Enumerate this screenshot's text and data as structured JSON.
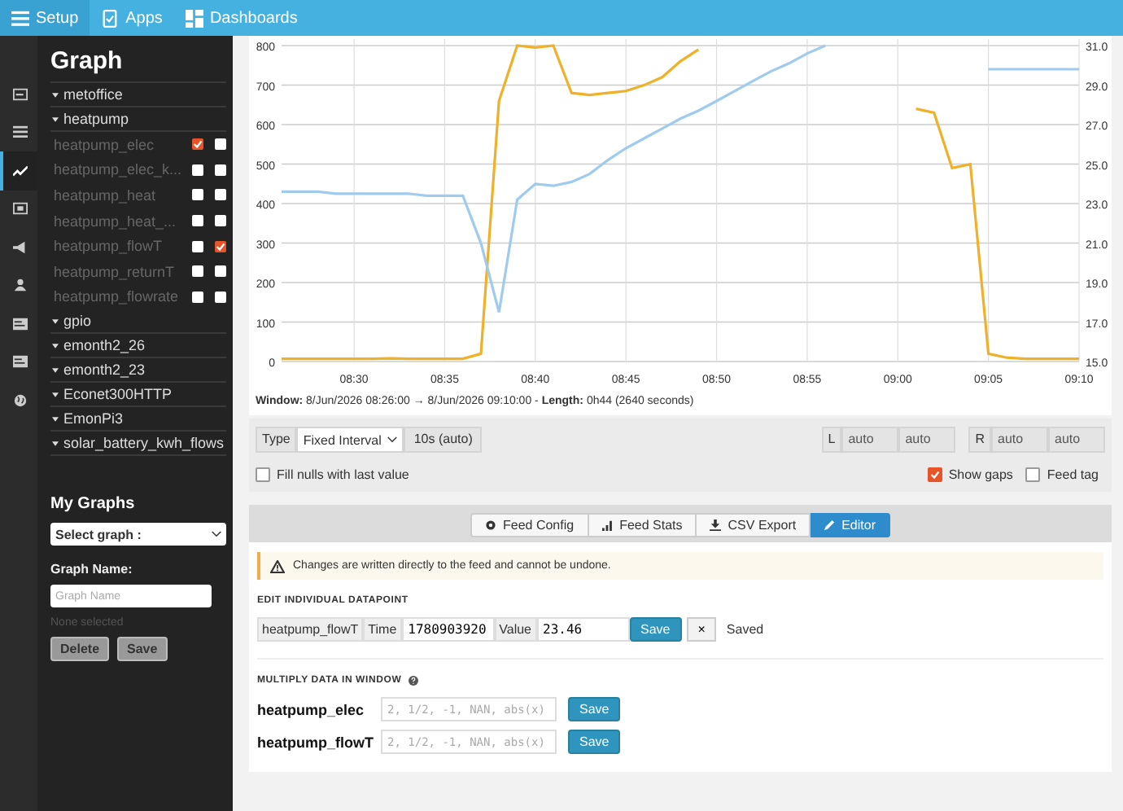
{
  "navbar": {
    "items": [
      {
        "label": "Setup",
        "kind": "menu",
        "selected": true
      },
      {
        "label": "Apps",
        "kind": "apps",
        "selected": false
      },
      {
        "label": "Dashboards",
        "kind": "dashboards",
        "selected": false
      }
    ]
  },
  "rail": [
    {
      "kind": "input",
      "selected": false
    },
    {
      "kind": "list",
      "selected": false
    },
    {
      "kind": "graph",
      "selected": true
    },
    {
      "kind": "box",
      "selected": false
    },
    {
      "kind": "megaphone",
      "selected": false
    },
    {
      "kind": "user",
      "selected": false
    },
    {
      "kind": "card",
      "selected": false
    },
    {
      "kind": "card",
      "selected": false
    },
    {
      "kind": "globe",
      "selected": false
    }
  ],
  "sidebar": {
    "title": "Graph",
    "groups": [
      {
        "name": "metoffice"
      },
      {
        "name": "heatpump",
        "children": [
          {
            "name": "heatpump_elec",
            "left": true,
            "right": false
          },
          {
            "name": "heatpump_elec_k...",
            "left": false,
            "right": false
          },
          {
            "name": "heatpump_heat",
            "left": false,
            "right": false
          },
          {
            "name": "heatpump_heat_...",
            "left": false,
            "right": false
          },
          {
            "name": "heatpump_flowT",
            "left": false,
            "right": true
          },
          {
            "name": "heatpump_returnT",
            "left": false,
            "right": false
          },
          {
            "name": "heatpump_flowrate",
            "left": false,
            "right": false
          }
        ]
      },
      {
        "name": "gpio"
      },
      {
        "name": "emonth2_26"
      },
      {
        "name": "emonth2_23"
      },
      {
        "name": "Econet300HTTP"
      },
      {
        "name": "EmonPi3"
      },
      {
        "name": "solar_battery_kwh_flows"
      }
    ],
    "my_graphs": {
      "title": "My Graphs",
      "select": "Select graph :",
      "name_label": "Graph Name:",
      "name_placeholder": "Graph Name",
      "status": "None selected",
      "buttons": [
        "Delete",
        "Save"
      ]
    }
  },
  "chart": {
    "chart_data": {
      "type": "line",
      "categories": [
        null,
        null,
        null,
        null,
        "08:30",
        null,
        null,
        null,
        null,
        "08:35",
        null,
        null,
        null,
        null,
        "08:40",
        null,
        null,
        null,
        null,
        "08:45",
        null,
        null,
        null,
        null,
        "08:50",
        null,
        null,
        null,
        null,
        "08:55",
        null,
        null,
        null,
        null,
        "09:00",
        null,
        null,
        null,
        null,
        "09:05",
        null,
        null,
        null,
        null,
        "09:10"
      ],
      "series": [
        {
          "color": "#efb02a",
          "values": [
            7,
            7,
            7,
            7,
            7,
            7,
            8,
            7,
            7,
            7,
            7,
            20,
            660,
            800,
            795,
            800,
            680,
            675,
            680,
            685,
            700,
            720,
            760,
            790,
            null,
            null,
            null,
            null,
            null,
            null,
            null,
            null,
            null,
            null,
            null,
            640,
            630,
            490,
            500,
            20,
            10,
            7,
            7,
            7,
            7
          ]
        },
        {
          "color": "#9fcbee",
          "axis": "y2",
          "values": [
            23.6,
            23.6,
            23.6,
            23.5,
            23.5,
            23.5,
            23.5,
            23.5,
            23.4,
            23.4,
            23.4,
            21,
            17.5,
            23.2,
            24,
            23.9,
            24.1,
            24.5,
            25.2,
            25.8,
            26.3,
            26.8,
            27.3,
            27.7,
            28.2,
            28.7,
            29.2,
            29.7,
            30.1,
            30.6,
            31,
            null,
            null,
            null,
            null,
            null,
            null,
            null,
            null,
            29.8,
            29.8,
            29.8,
            29.8,
            29.8,
            29.8
          ]
        }
      ],
      "grid": true,
      "ylim": [
        0,
        800
      ],
      "y2lim": [
        15,
        31
      ],
      "yticks": [
        0,
        100,
        200,
        300,
        400,
        500,
        600,
        700,
        800
      ],
      "y2ticks": [
        {
          "value": 15,
          "label": "15.0"
        },
        {
          "value": 17,
          "label": "17.0"
        },
        {
          "value": 19,
          "label": "19.0"
        },
        {
          "value": 21,
          "label": "21.0"
        },
        {
          "value": 23,
          "label": "23.0"
        },
        {
          "value": 25,
          "label": "25.0"
        },
        {
          "value": 27,
          "label": "27.0"
        },
        {
          "value": 29,
          "label": "29.0"
        },
        {
          "value": 31,
          "label": "31.0"
        }
      ]
    },
    "window_info": "**Window:** 8/Jun/2026 08:26:00 → 8/Jun/2026 09:10:00  -  **Length:** 0h44 (2640 seconds)"
  },
  "controls": {
    "type_label": "Type",
    "type_value": "Fixed Interval",
    "interval": "10s (auto)",
    "left_label": "L",
    "left_min": "auto",
    "left_max": "auto",
    "right_label": "R",
    "right_min": "auto",
    "right_max": "auto",
    "options": [
      {
        "label": "Fill nulls with last value",
        "checked": false
      },
      {
        "label": "Show gaps",
        "checked": true
      },
      {
        "label": "Feed tag",
        "checked": false
      }
    ]
  },
  "tabs": [
    {
      "label": "Feed Config",
      "kind": "config",
      "selected": false
    },
    {
      "label": "Feed Stats",
      "kind": "stats",
      "selected": false
    },
    {
      "label": "CSV Export",
      "kind": "export",
      "selected": false
    },
    {
      "label": "Editor",
      "kind": "editor",
      "selected": true
    }
  ],
  "editor": {
    "warning": "Changes are written directly to the feed and cannot be undone.",
    "edit_heading": "EDIT INDIVIDUAL DATAPOINT",
    "datapoint": {
      "feed": "heatpump_flowT",
      "time_label": "Time",
      "time": "1780903920",
      "value_label": "Value",
      "value": "23.46",
      "save": "Save",
      "clear": "×",
      "status": "Saved"
    },
    "multiply_heading": "MULTIPLY DATA IN WINDOW",
    "multiply_rows": [
      {
        "feed": "heatpump_elec",
        "placeholder": "2, 1/2, -1, NAN, abs(x)",
        "save": "Save"
      },
      {
        "feed": "heatpump_flowT",
        "placeholder": "2, 1/2, -1, NAN, abs(x)",
        "save": "Save"
      }
    ]
  }
}
